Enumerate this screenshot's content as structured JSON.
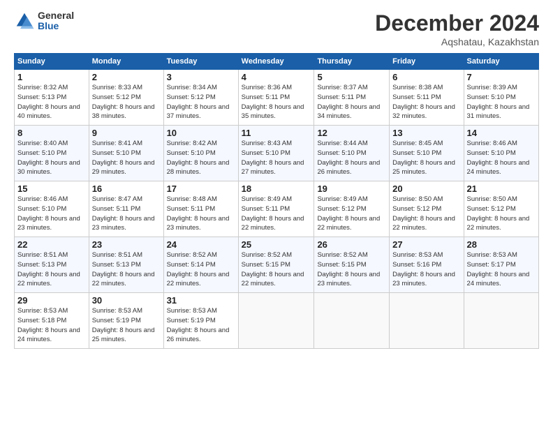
{
  "header": {
    "logo": {
      "general": "General",
      "blue": "Blue"
    },
    "title": "December 2024",
    "location": "Aqshatau, Kazakhstan"
  },
  "weekdays": [
    "Sunday",
    "Monday",
    "Tuesday",
    "Wednesday",
    "Thursday",
    "Friday",
    "Saturday"
  ],
  "weeks": [
    [
      {
        "day": "1",
        "sunrise": "8:32 AM",
        "sunset": "5:13 PM",
        "daylight": "8 hours and 40 minutes."
      },
      {
        "day": "2",
        "sunrise": "8:33 AM",
        "sunset": "5:12 PM",
        "daylight": "8 hours and 38 minutes."
      },
      {
        "day": "3",
        "sunrise": "8:34 AM",
        "sunset": "5:12 PM",
        "daylight": "8 hours and 37 minutes."
      },
      {
        "day": "4",
        "sunrise": "8:36 AM",
        "sunset": "5:11 PM",
        "daylight": "8 hours and 35 minutes."
      },
      {
        "day": "5",
        "sunrise": "8:37 AM",
        "sunset": "5:11 PM",
        "daylight": "8 hours and 34 minutes."
      },
      {
        "day": "6",
        "sunrise": "8:38 AM",
        "sunset": "5:11 PM",
        "daylight": "8 hours and 32 minutes."
      },
      {
        "day": "7",
        "sunrise": "8:39 AM",
        "sunset": "5:10 PM",
        "daylight": "8 hours and 31 minutes."
      }
    ],
    [
      {
        "day": "8",
        "sunrise": "8:40 AM",
        "sunset": "5:10 PM",
        "daylight": "8 hours and 30 minutes."
      },
      {
        "day": "9",
        "sunrise": "8:41 AM",
        "sunset": "5:10 PM",
        "daylight": "8 hours and 29 minutes."
      },
      {
        "day": "10",
        "sunrise": "8:42 AM",
        "sunset": "5:10 PM",
        "daylight": "8 hours and 28 minutes."
      },
      {
        "day": "11",
        "sunrise": "8:43 AM",
        "sunset": "5:10 PM",
        "daylight": "8 hours and 27 minutes."
      },
      {
        "day": "12",
        "sunrise": "8:44 AM",
        "sunset": "5:10 PM",
        "daylight": "8 hours and 26 minutes."
      },
      {
        "day": "13",
        "sunrise": "8:45 AM",
        "sunset": "5:10 PM",
        "daylight": "8 hours and 25 minutes."
      },
      {
        "day": "14",
        "sunrise": "8:46 AM",
        "sunset": "5:10 PM",
        "daylight": "8 hours and 24 minutes."
      }
    ],
    [
      {
        "day": "15",
        "sunrise": "8:46 AM",
        "sunset": "5:10 PM",
        "daylight": "8 hours and 23 minutes."
      },
      {
        "day": "16",
        "sunrise": "8:47 AM",
        "sunset": "5:11 PM",
        "daylight": "8 hours and 23 minutes."
      },
      {
        "day": "17",
        "sunrise": "8:48 AM",
        "sunset": "5:11 PM",
        "daylight": "8 hours and 23 minutes."
      },
      {
        "day": "18",
        "sunrise": "8:49 AM",
        "sunset": "5:11 PM",
        "daylight": "8 hours and 22 minutes."
      },
      {
        "day": "19",
        "sunrise": "8:49 AM",
        "sunset": "5:12 PM",
        "daylight": "8 hours and 22 minutes."
      },
      {
        "day": "20",
        "sunrise": "8:50 AM",
        "sunset": "5:12 PM",
        "daylight": "8 hours and 22 minutes."
      },
      {
        "day": "21",
        "sunrise": "8:50 AM",
        "sunset": "5:12 PM",
        "daylight": "8 hours and 22 minutes."
      }
    ],
    [
      {
        "day": "22",
        "sunrise": "8:51 AM",
        "sunset": "5:13 PM",
        "daylight": "8 hours and 22 minutes."
      },
      {
        "day": "23",
        "sunrise": "8:51 AM",
        "sunset": "5:13 PM",
        "daylight": "8 hours and 22 minutes."
      },
      {
        "day": "24",
        "sunrise": "8:52 AM",
        "sunset": "5:14 PM",
        "daylight": "8 hours and 22 minutes."
      },
      {
        "day": "25",
        "sunrise": "8:52 AM",
        "sunset": "5:15 PM",
        "daylight": "8 hours and 22 minutes."
      },
      {
        "day": "26",
        "sunrise": "8:52 AM",
        "sunset": "5:15 PM",
        "daylight": "8 hours and 23 minutes."
      },
      {
        "day": "27",
        "sunrise": "8:53 AM",
        "sunset": "5:16 PM",
        "daylight": "8 hours and 23 minutes."
      },
      {
        "day": "28",
        "sunrise": "8:53 AM",
        "sunset": "5:17 PM",
        "daylight": "8 hours and 24 minutes."
      }
    ],
    [
      {
        "day": "29",
        "sunrise": "8:53 AM",
        "sunset": "5:18 PM",
        "daylight": "8 hours and 24 minutes."
      },
      {
        "day": "30",
        "sunrise": "8:53 AM",
        "sunset": "5:19 PM",
        "daylight": "8 hours and 25 minutes."
      },
      {
        "day": "31",
        "sunrise": "8:53 AM",
        "sunset": "5:19 PM",
        "daylight": "8 hours and 26 minutes."
      },
      null,
      null,
      null,
      null
    ]
  ]
}
